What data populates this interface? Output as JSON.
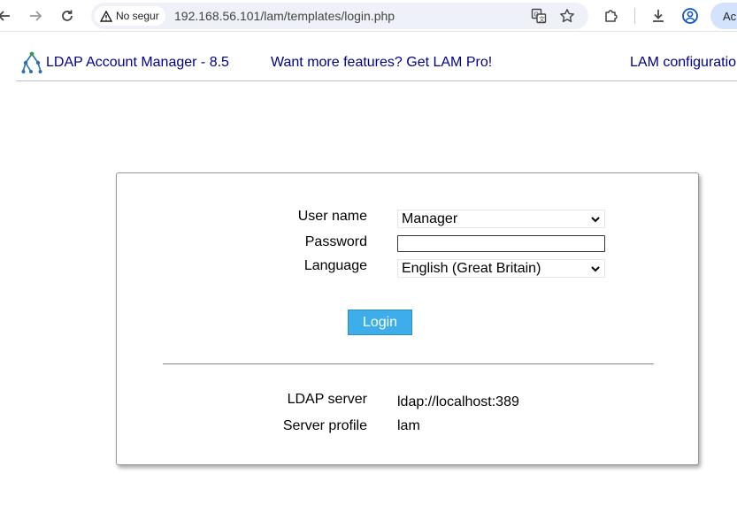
{
  "browser": {
    "security_chip": "No segur",
    "url": "192.168.56.101/lam/templates/login.php",
    "profile_label": "Ac"
  },
  "header": {
    "brand": "LDAP Account Manager - 8.5",
    "pro_link": "Want more features? Get LAM Pro!",
    "config_link": "LAM configuratio"
  },
  "login": {
    "username_label": "User name",
    "username_value": "Manager",
    "password_label": "Password",
    "password_value": "",
    "language_label": "Language",
    "language_value": "English (Great Britain)",
    "login_button": "Login",
    "ldap_server_label": "LDAP server",
    "ldap_server_value": "ldap://localhost:389",
    "server_profile_label": "Server profile",
    "server_profile_value": "lam"
  },
  "colors": {
    "link": "#00008b",
    "button": "#3daee9"
  }
}
